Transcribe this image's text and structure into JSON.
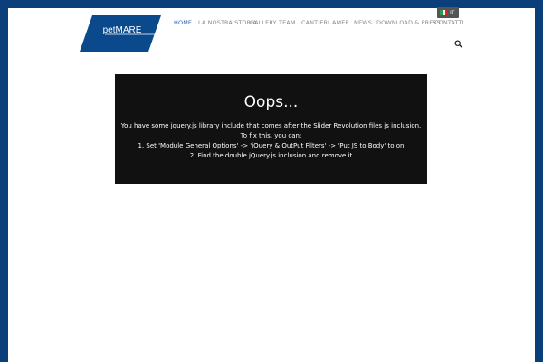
{
  "header": {
    "logo_text": "petMARE",
    "nav": [
      {
        "label": "HOME",
        "active": true
      },
      {
        "label": "LA NOSTRA STORIA",
        "active": false
      },
      {
        "label": "GALLERY",
        "active": false
      },
      {
        "label": "TEAM",
        "active": false
      },
      {
        "label": "CANTIERI",
        "active": false
      },
      {
        "label": "AMER",
        "active": false
      },
      {
        "label": "NEWS",
        "active": false
      },
      {
        "label": "DOWNLOAD & PRESS",
        "active": false
      },
      {
        "label": "CONTATTI",
        "active": false
      }
    ],
    "language": {
      "code": "IT",
      "icon": "italy-flag-icon"
    },
    "search_icon": "search-icon"
  },
  "error": {
    "title": "Oops...",
    "lines": [
      "You have some jquery.js library include that comes after the Slider Revolution files js inclusion.",
      "To fix this, you can:",
      "1. Set 'Module General Options' -> 'jQuery & OutPut Filters' -> 'Put JS to Body' to on",
      "2. Find the double jQuery.js inclusion and remove it"
    ]
  },
  "colors": {
    "frame": "#0a3f7a",
    "accent": "#2b6aa8",
    "logo": "#0a4a8c",
    "error_bg": "#111111"
  }
}
